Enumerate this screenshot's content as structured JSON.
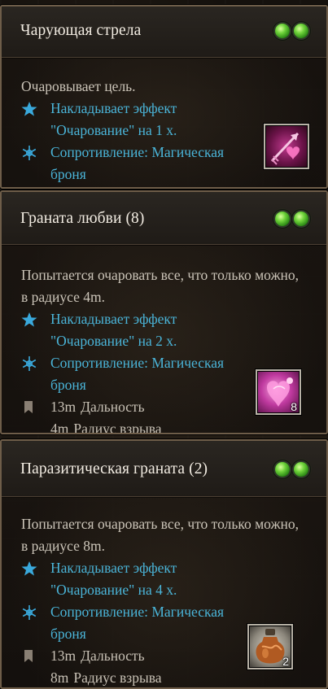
{
  "tooltips": [
    {
      "title": "Чарующая стрела",
      "description": "Очаровывает цель.",
      "effect_1": "Накладывает эффект \"Очарование\" на 1 х.",
      "effect_2": "Сопротивление: Магическая броня",
      "effect_1_icon": "star-icon",
      "effect_2_icon": "snowflake-icon",
      "item_icon": "charm-arrow-icon",
      "orb_icons": [
        "action-orb-icon",
        "action-orb-icon"
      ]
    },
    {
      "title": "Граната любви (8)",
      "description": "Попытается очаровать все, что только можно, в радиусе 4m.",
      "effect_1": "Накладывает эффект \"Очарование\" на 2 х.",
      "effect_2": "Сопротивление: Магическая броня",
      "range_value": "13m",
      "range_label": "Дальность",
      "radius_value": "4m",
      "radius_label": "Радиус взрыва",
      "item_count": "8",
      "item_icon": "love-grenade-icon"
    },
    {
      "title": "Паразитическая граната (2)",
      "description": "Попытается очаровать все, что только можно, в радиусе 8m.",
      "effect_1": "Накладывает эффект \"Очарование\" на 4 х.",
      "effect_2": "Сопротивление: Магическая броня",
      "range_value": "13m",
      "range_label": "Дальность",
      "radius_value": "8m",
      "radius_label": "Радиус взрыва",
      "item_count": "2",
      "item_icon": "parasite-grenade-icon"
    }
  ],
  "colors": {
    "title": "#f2ece2",
    "text": "#cbc4b8",
    "effect": "#4ab4d8",
    "orb": "#6ed23a",
    "border": "#6e5d49"
  }
}
